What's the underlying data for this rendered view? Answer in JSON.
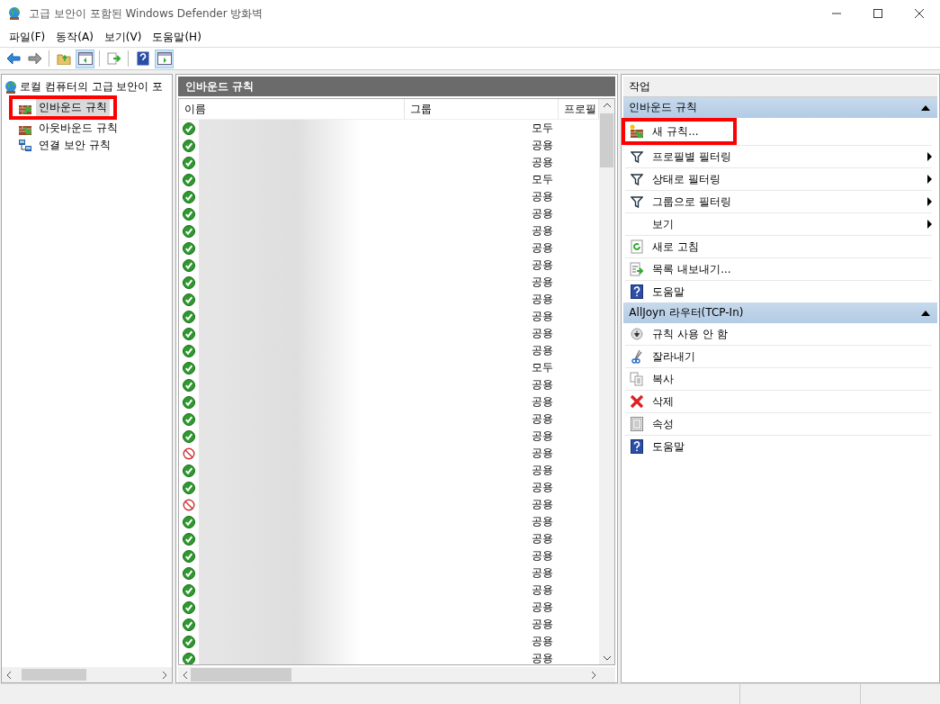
{
  "window": {
    "title": "고급 보안이 포함된 Windows Defender 방화벽"
  },
  "menu": [
    "파일(F)",
    "동작(A)",
    "보기(V)",
    "도움말(H)"
  ],
  "tree": {
    "label": "로컬 컴퓨터의 고급 보안이 포",
    "children": [
      {
        "label": "인바운드 규칙",
        "selected": true,
        "highlighted": true
      },
      {
        "label": "아웃바운드 규칙",
        "selected": false,
        "highlighted": false
      },
      {
        "label": "연결 보안 규칙",
        "selected": false,
        "highlighted": false
      }
    ]
  },
  "rules": {
    "title": "인바운드 규칙",
    "columns": [
      "이름",
      "그룹",
      "프로필"
    ],
    "rows": [
      {
        "enabled": true,
        "profile": "모두"
      },
      {
        "enabled": true,
        "profile": "공용"
      },
      {
        "enabled": true,
        "profile": "공용"
      },
      {
        "enabled": true,
        "profile": "모두"
      },
      {
        "enabled": true,
        "profile": "공용"
      },
      {
        "enabled": true,
        "profile": "공용"
      },
      {
        "enabled": true,
        "profile": "공용"
      },
      {
        "enabled": true,
        "profile": "공용"
      },
      {
        "enabled": true,
        "profile": "공용"
      },
      {
        "enabled": true,
        "profile": "공용"
      },
      {
        "enabled": true,
        "profile": "공용"
      },
      {
        "enabled": true,
        "profile": "공용"
      },
      {
        "enabled": true,
        "profile": "공용"
      },
      {
        "enabled": true,
        "profile": "공용"
      },
      {
        "enabled": true,
        "profile": "모두"
      },
      {
        "enabled": true,
        "profile": "공용"
      },
      {
        "enabled": true,
        "profile": "공용"
      },
      {
        "enabled": true,
        "profile": "공용"
      },
      {
        "enabled": true,
        "profile": "공용"
      },
      {
        "enabled": false,
        "profile": "공용"
      },
      {
        "enabled": true,
        "profile": "공용"
      },
      {
        "enabled": true,
        "profile": "공용"
      },
      {
        "enabled": false,
        "profile": "공용"
      },
      {
        "enabled": true,
        "profile": "공용"
      },
      {
        "enabled": true,
        "profile": "공용"
      },
      {
        "enabled": true,
        "profile": "공용"
      },
      {
        "enabled": true,
        "profile": "공용"
      },
      {
        "enabled": true,
        "profile": "공용"
      },
      {
        "enabled": true,
        "profile": "공용"
      },
      {
        "enabled": true,
        "profile": "공용"
      },
      {
        "enabled": true,
        "profile": "공용"
      },
      {
        "enabled": true,
        "profile": "공용"
      }
    ]
  },
  "actions": {
    "title": "작업",
    "sections": [
      {
        "title": "인바운드 규칙",
        "expanded": true,
        "items": [
          {
            "kind": "new",
            "label": "새 규칙...",
            "submenu": false,
            "highlighted": true
          },
          {
            "kind": "filter",
            "label": "프로필별 필터링",
            "submenu": true,
            "highlighted": false
          },
          {
            "kind": "filter",
            "label": "상태로 필터링",
            "submenu": true,
            "highlighted": false
          },
          {
            "kind": "filter",
            "label": "그룹으로 필터링",
            "submenu": true,
            "highlighted": false
          },
          {
            "kind": "none",
            "label": "보기",
            "submenu": true,
            "highlighted": false
          },
          {
            "kind": "refresh",
            "label": "새로 고침",
            "submenu": false,
            "highlighted": false
          },
          {
            "kind": "export",
            "label": "목록 내보내기...",
            "submenu": false,
            "highlighted": false
          },
          {
            "kind": "help",
            "label": "도움말",
            "submenu": false,
            "highlighted": false
          }
        ]
      },
      {
        "title": "AllJoyn 라우터(TCP-In)",
        "expanded": true,
        "items": [
          {
            "kind": "disable",
            "label": "규칙 사용 안 함",
            "submenu": false,
            "highlighted": false
          },
          {
            "kind": "cut",
            "label": "잘라내기",
            "submenu": false,
            "highlighted": false
          },
          {
            "kind": "copy",
            "label": "복사",
            "submenu": false,
            "highlighted": false
          },
          {
            "kind": "delete",
            "label": "삭제",
            "submenu": false,
            "highlighted": false
          },
          {
            "kind": "properties",
            "label": "속성",
            "submenu": false,
            "highlighted": false
          },
          {
            "kind": "help",
            "label": "도움말",
            "submenu": false,
            "highlighted": false
          }
        ]
      }
    ]
  }
}
